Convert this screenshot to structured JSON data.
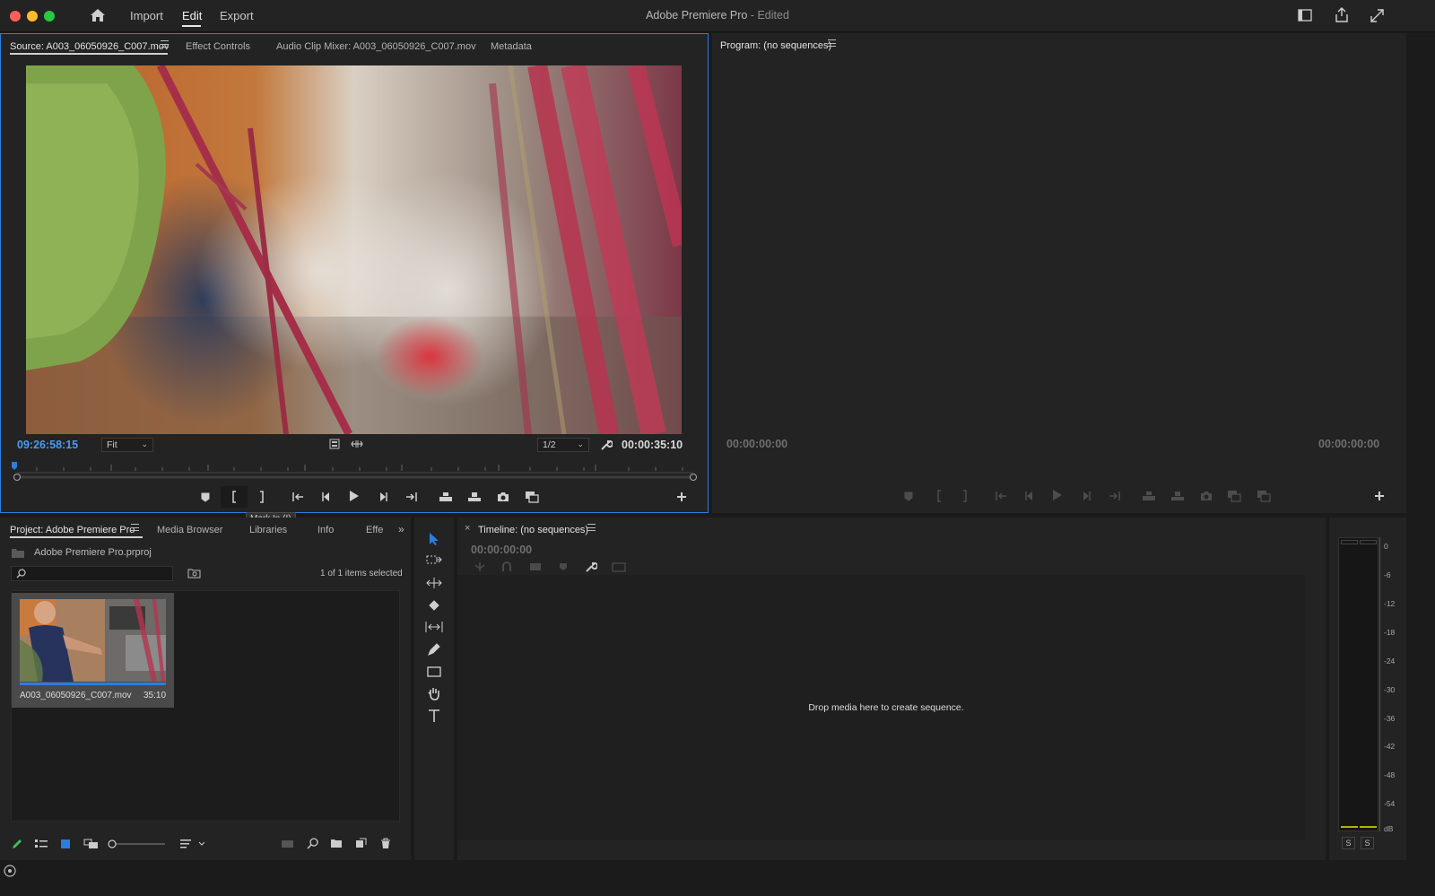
{
  "titlebar": {
    "menu": [
      "Import",
      "Edit",
      "Export"
    ],
    "app_name": "Adobe Premiere Pro",
    "app_status": "- Edited"
  },
  "source": {
    "tabs": [
      "Source: A003_06050926_C007.mov",
      "Effect Controls",
      "Audio Clip Mixer: A003_06050926_C007.mov",
      "Metadata"
    ],
    "timecode_in": "09:26:58:15",
    "zoom": "Fit",
    "resolution": "1/2",
    "duration": "00:00:35:10",
    "tooltip": "Mark In (I)"
  },
  "program": {
    "title": "Program: (no sequences)",
    "timecode_left": "00:00:00:00",
    "timecode_right": "00:00:00:00"
  },
  "project": {
    "tabs": [
      "Project: Adobe Premiere Pro",
      "Media Browser",
      "Libraries",
      "Info",
      "Effe"
    ],
    "project_file": "Adobe Premiere Pro.prproj",
    "search_placeholder": "",
    "selection_status": "1 of 1 items selected",
    "clip": {
      "name": "A003_06050926_C007.mov",
      "duration": "35:10"
    }
  },
  "timeline": {
    "title": "Timeline: (no sequences)",
    "timecode": "00:00:00:00",
    "empty_message": "Drop media here to create sequence."
  },
  "meter": {
    "scale": [
      "0",
      "-6",
      "-12",
      "-18",
      "-24",
      "-30",
      "-36",
      "-42",
      "-48",
      "-54",
      "dB"
    ],
    "solo_left": "S",
    "solo_right": "S"
  },
  "icons": {
    "home": "home-icon",
    "search": "search-icon",
    "wrench": "wrench-icon",
    "camera": "export-frame-icon"
  },
  "colors": {
    "accent": "#2d7ddc",
    "timecode": "#4a9bf2",
    "panel_bg": "#232323",
    "app_bg": "#1b1b1b"
  }
}
